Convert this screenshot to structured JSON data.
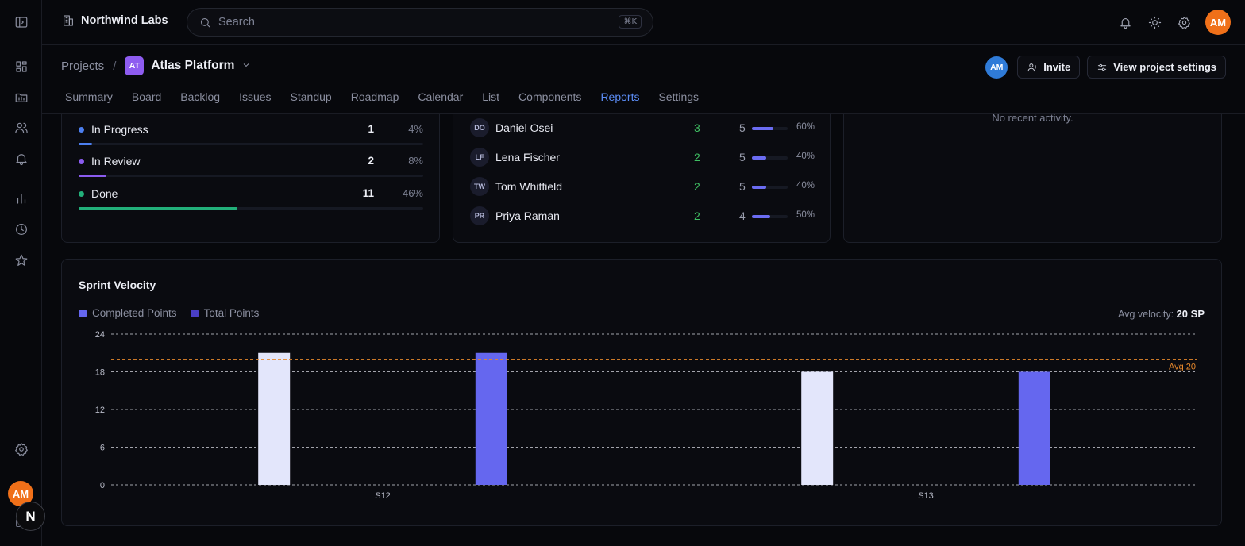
{
  "org": {
    "name": "Northwind Labs"
  },
  "search": {
    "placeholder": "Search",
    "shortcut": "⌘K"
  },
  "user": {
    "initials": "AM"
  },
  "breadcrumb": {
    "root": "Projects",
    "separator": "/",
    "project_badge": "AT",
    "project_name": "Atlas Platform"
  },
  "header_actions": {
    "member_initials": "AM",
    "invite_label": "Invite",
    "settings_label": "View project settings"
  },
  "tabs": [
    "Summary",
    "Board",
    "Backlog",
    "Issues",
    "Standup",
    "Roadmap",
    "Calendar",
    "List",
    "Components",
    "Reports",
    "Settings"
  ],
  "active_tab": "Reports",
  "status_breakdown": [
    {
      "label": "In Progress",
      "count": "1",
      "pct": "4%",
      "fraction": 0.04,
      "color": "#4c7ff0"
    },
    {
      "label": "In Review",
      "count": "2",
      "pct": "8%",
      "fraction": 0.08,
      "color": "#8b5cf0"
    },
    {
      "label": "Done",
      "count": "11",
      "pct": "46%",
      "fraction": 0.46,
      "color": "#22b07a"
    }
  ],
  "workload": [
    {
      "initials": "DO",
      "name": "Daniel Osei",
      "done": "3",
      "total": "5",
      "pct": "60%",
      "fraction": 0.6
    },
    {
      "initials": "LF",
      "name": "Lena Fischer",
      "done": "2",
      "total": "5",
      "pct": "40%",
      "fraction": 0.4
    },
    {
      "initials": "TW",
      "name": "Tom Whitfield",
      "done": "2",
      "total": "5",
      "pct": "40%",
      "fraction": 0.4
    },
    {
      "initials": "PR",
      "name": "Priya Raman",
      "done": "2",
      "total": "4",
      "pct": "50%",
      "fraction": 0.5
    }
  ],
  "activity": {
    "empty_text": "No recent activity."
  },
  "velocity": {
    "title": "Sprint Velocity",
    "avg_label": "Avg velocity:",
    "avg_value": "20 SP"
  },
  "chart_data": {
    "type": "bar",
    "title": "Sprint Velocity",
    "categories": [
      "S12",
      "S13"
    ],
    "series": [
      {
        "name": "Completed Points",
        "values": [
          21,
          18
        ],
        "color": "#e3e6fb"
      },
      {
        "name": "Total Points",
        "values": [
          21,
          18
        ],
        "color": "#6567ef"
      }
    ],
    "legend_colors": [
      "#6567ef",
      "#4a3fc6"
    ],
    "y_ticks": [
      0,
      6,
      12,
      18,
      24
    ],
    "ylim": [
      0,
      24
    ],
    "reference_line": {
      "value": 20,
      "label": "Avg 20",
      "color": "#e8892c"
    },
    "grid": true,
    "legend": "top-left"
  }
}
